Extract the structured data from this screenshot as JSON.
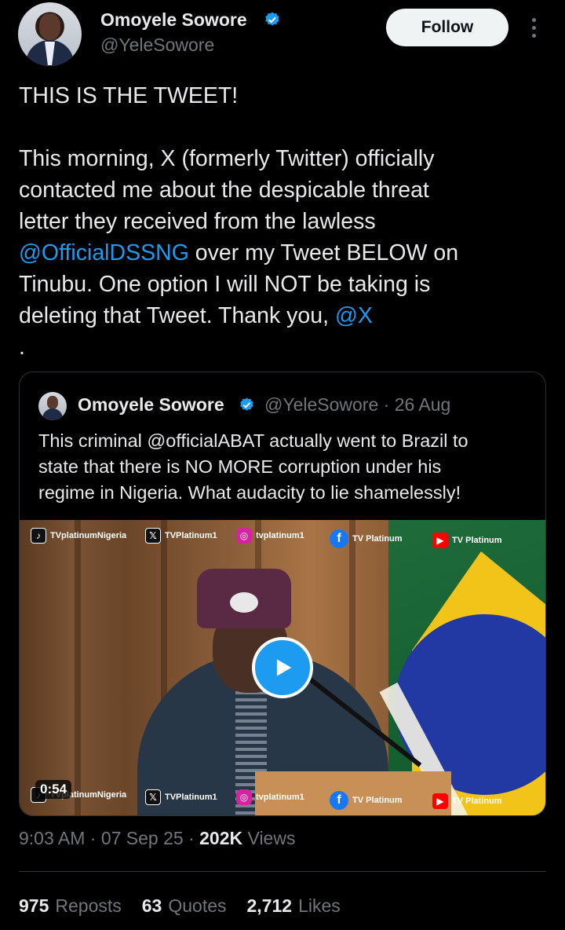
{
  "author": {
    "name": "Omoyele Sowore",
    "handle": "@YeleSowore"
  },
  "follow_label": "Follow",
  "tweet": {
    "line_heading": "THIS IS THE TWEET!",
    "line1": "This morning, X (formerly Twitter) officially",
    "line2": "contacted me about the despicable threat",
    "line3": "letter they received from the lawless",
    "mention_dss": "@OfficialDSSNG",
    "line4_rest": " over my Tweet BELOW  on",
    "line5": "Tinubu. One option I will NOT be taking is",
    "line6_pre": "deleting that Tweet. Thank you, ",
    "mention_x": "@X",
    "line7": "."
  },
  "quote": {
    "name": "Omoyele Sowore",
    "meta": "@YeleSowore · 26 Aug",
    "line1": "This criminal @officialABAT actually went to Brazil to",
    "line2": "state that there is NO MORE corruption under his",
    "line3": "regime in Nigeria. What audacity to lie shamelessly!",
    "video": {
      "duration": "0:54",
      "watermarks_top": {
        "tiktok": "TVplatinumNigeria",
        "x": "TVPlatinum1",
        "instagram": "tvplatinum1",
        "facebook": "TV Platinum",
        "youtube": "TV Platinum"
      },
      "watermarks_bottom": {
        "tiktok": "TVplatinumNigeria",
        "x": "TVPlatinum1",
        "instagram": "tvplatinum1",
        "facebook": "TV Platinum",
        "youtube": "TV Platinum"
      }
    }
  },
  "timestamp": {
    "time_date": "9:03 AM · 07 Sep 25 · ",
    "views_count": "202K",
    "views_label": " Views"
  },
  "stats": {
    "reposts_count": "975",
    "reposts_label": "Reposts",
    "quotes_count": "63",
    "quotes_label": "Quotes",
    "likes_count": "2,712",
    "likes_label": "Likes"
  },
  "colors": {
    "accent": "#1d9bf0",
    "muted": "#71767b",
    "text": "#e7e9ea",
    "background": "#000000"
  }
}
